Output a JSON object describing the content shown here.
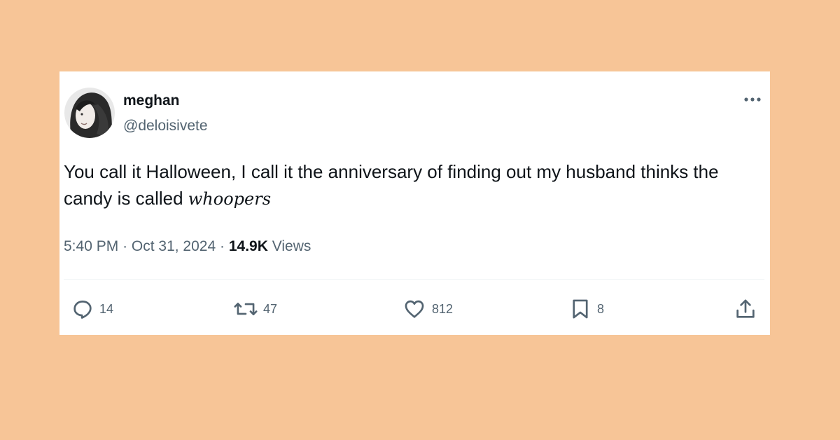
{
  "tweet": {
    "display_name": "meghan",
    "handle": "@deloisivete",
    "text_main": "You call it Halloween, I call it the anniversary of finding out my husband thinks the candy is called ",
    "text_emphasis": "whoopers",
    "time": "5:40 PM",
    "date": "Oct 31, 2024",
    "separator": "·",
    "views_count": "14.9K",
    "views_label": "Views"
  },
  "actions": {
    "replies": "14",
    "reposts": "47",
    "likes": "812",
    "bookmarks": "8"
  },
  "colors": {
    "background": "#f7c597",
    "card": "#ffffff",
    "text_primary": "#0f1419",
    "text_secondary": "#536471"
  },
  "icons": [
    "reply-icon",
    "repost-icon",
    "like-icon",
    "bookmark-icon",
    "share-icon",
    "more-icon"
  ]
}
